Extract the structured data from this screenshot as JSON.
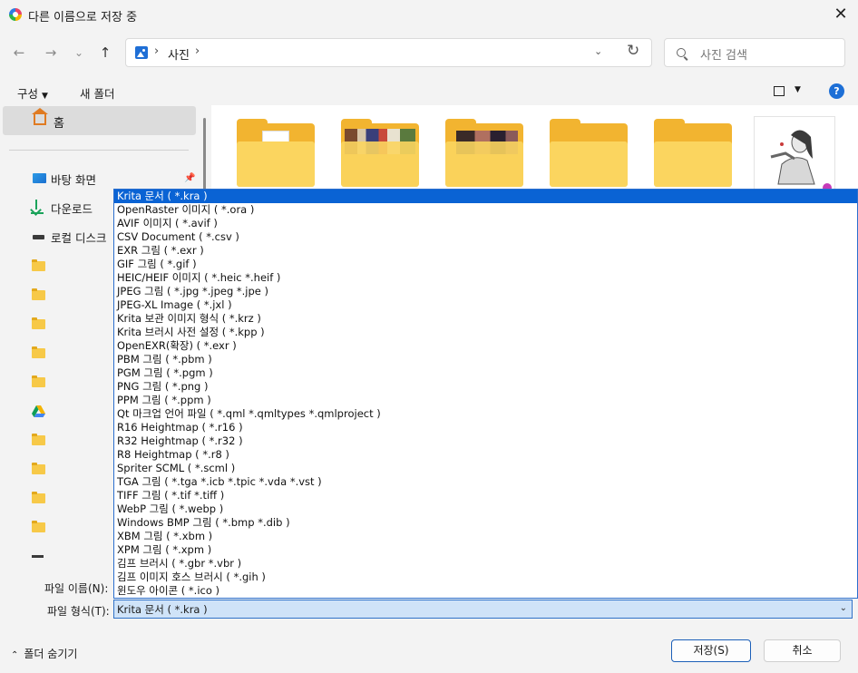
{
  "window": {
    "title": "다른 이름으로 저장 중",
    "close_glyph": "✕"
  },
  "nav": {
    "back_glyph": "←",
    "forward_glyph": "→",
    "recent_glyph": "⌄",
    "up_glyph": "↑",
    "breadcrumb": [
      "사진"
    ],
    "separator": "›",
    "refresh_glyph": "↻",
    "dropdown_glyph": "⌄",
    "search_placeholder": "사진 검색"
  },
  "toolbar": {
    "organize_label": "구성",
    "new_folder_label": "새 폴더",
    "help_label": "?"
  },
  "sidebar": {
    "home_label": "홈",
    "quick_access": [
      {
        "label": "바탕 화면",
        "icon": "desktop-icon",
        "pinned": true
      },
      {
        "label": "다운로드",
        "icon": "downloads-icon",
        "pinned": false
      },
      {
        "label": "로컬 디스크",
        "icon": "disk-icon",
        "pinned": false
      }
    ],
    "folder_icons": [
      "folder-icon",
      "folder-icon",
      "folder-icon",
      "folder-icon",
      "folder-icon",
      "google-drive-icon",
      "folder-icon",
      "folder-icon",
      "folder-icon",
      "folder-icon",
      "disk-icon"
    ],
    "pin_glyph": "📌"
  },
  "file_types": [
    "Krita 문서 ( *.kra )",
    "OpenRaster 이미지 ( *.ora )",
    "AVIF 이미지 ( *.avif )",
    "CSV Document ( *.csv )",
    "EXR 그림 ( *.exr )",
    "GIF 그림 ( *.gif )",
    "HEIC/HEIF 이미지 ( *.heic *.heif )",
    "JPEG 그림 ( *.jpg *.jpeg *.jpe )",
    "JPEG-XL Image ( *.jxl )",
    "Krita 보관 이미지 형식 ( *.krz )",
    "Krita 브러시 사전 설정 ( *.kpp )",
    "OpenEXR(확장) ( *.exr )",
    "PBM 그림 ( *.pbm )",
    "PGM 그림 ( *.pgm )",
    "PNG 그림 ( *.png )",
    "PPM 그림 ( *.ppm )",
    "Qt 마크업 언어 파일 ( *.qml *.qmltypes *.qmlproject )",
    "R16 Heightmap ( *.r16 )",
    "R32 Heightmap ( *.r32 )",
    "R8 Heightmap ( *.r8 )",
    "Spriter SCML ( *.scml )",
    "TGA 그림 ( *.tga *.icb *.tpic *.vda *.vst )",
    "TIFF 그림 ( *.tif *.tiff )",
    "WebP 그림 ( *.webp )",
    "Windows BMP 그림 ( *.bmp *.dib )",
    "XBM 그림 ( *.xbm )",
    "XPM 그림 ( *.xpm )",
    "김프 브러시 ( *.gbr *.vbr )",
    "김프 이미지 호스 브러시 ( *.gih )",
    "윈도우 아이콘 ( *.ico )"
  ],
  "selected_file_type_index": 0,
  "form": {
    "file_name_label": "파일 이름(N):",
    "file_type_label": "파일 형식(T):",
    "file_type_value": "Krita 문서 ( *.kra )"
  },
  "footer": {
    "hide_folders_label": "폴더 숨기기",
    "save_label": "저장(S)",
    "cancel_label": "취소"
  },
  "colors": {
    "accent": "#0a63d4",
    "selection_field": "#cfe3f8",
    "folder": "#f7c948"
  }
}
